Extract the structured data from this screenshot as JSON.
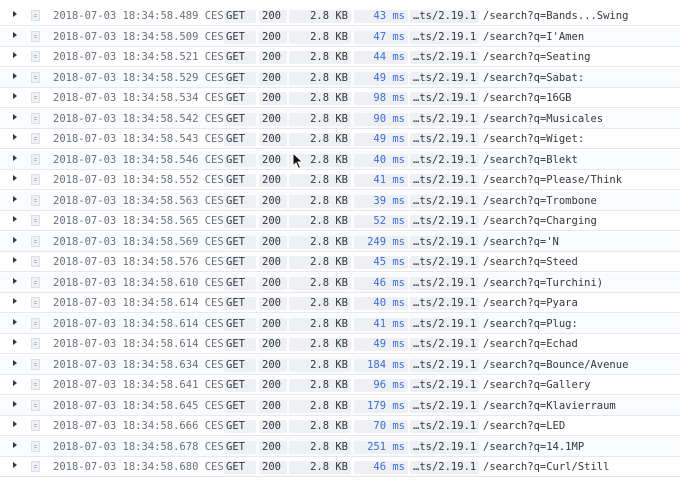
{
  "rows": [
    {
      "ts": "2018-07-03 18:34:58.489 CEST",
      "method": "GET",
      "status": "200",
      "bytes": "2.8 KB",
      "ms": "43 ms",
      "agent": "…ts/2.19.1",
      "url": "/search?q=Bands...Swing"
    },
    {
      "ts": "2018-07-03 18:34:58.509 CEST",
      "method": "GET",
      "status": "200",
      "bytes": "2.8 KB",
      "ms": "47 ms",
      "agent": "…ts/2.19.1",
      "url": "/search?q=I'Amen"
    },
    {
      "ts": "2018-07-03 18:34:58.521 CEST",
      "method": "GET",
      "status": "200",
      "bytes": "2.8 KB",
      "ms": "44 ms",
      "agent": "…ts/2.19.1",
      "url": "/search?q=Seating"
    },
    {
      "ts": "2018-07-03 18:34:58.529 CEST",
      "method": "GET",
      "status": "200",
      "bytes": "2.8 KB",
      "ms": "49 ms",
      "agent": "…ts/2.19.1",
      "url": "/search?q=Sabat:"
    },
    {
      "ts": "2018-07-03 18:34:58.534 CEST",
      "method": "GET",
      "status": "200",
      "bytes": "2.8 KB",
      "ms": "98 ms",
      "agent": "…ts/2.19.1",
      "url": "/search?q=16GB"
    },
    {
      "ts": "2018-07-03 18:34:58.542 CEST",
      "method": "GET",
      "status": "200",
      "bytes": "2.8 KB",
      "ms": "90 ms",
      "agent": "…ts/2.19.1",
      "url": "/search?q=Musicales"
    },
    {
      "ts": "2018-07-03 18:34:58.543 CEST",
      "method": "GET",
      "status": "200",
      "bytes": "2.8 KB",
      "ms": "49 ms",
      "agent": "…ts/2.19.1",
      "url": "/search?q=Wiget:"
    },
    {
      "ts": "2018-07-03 18:34:58.546 CEST",
      "method": "GET",
      "status": "200",
      "bytes": "2.8 KB",
      "ms": "40 ms",
      "agent": "…ts/2.19.1",
      "url": "/search?q=Blekt"
    },
    {
      "ts": "2018-07-03 18:34:58.552 CEST",
      "method": "GET",
      "status": "200",
      "bytes": "2.8 KB",
      "ms": "41 ms",
      "agent": "…ts/2.19.1",
      "url": "/search?q=Please/Think"
    },
    {
      "ts": "2018-07-03 18:34:58.563 CEST",
      "method": "GET",
      "status": "200",
      "bytes": "2.8 KB",
      "ms": "39 ms",
      "agent": "…ts/2.19.1",
      "url": "/search?q=Trombone"
    },
    {
      "ts": "2018-07-03 18:34:58.565 CEST",
      "method": "GET",
      "status": "200",
      "bytes": "2.8 KB",
      "ms": "52 ms",
      "agent": "…ts/2.19.1",
      "url": "/search?q=Charging"
    },
    {
      "ts": "2018-07-03 18:34:58.569 CEST",
      "method": "GET",
      "status": "200",
      "bytes": "2.8 KB",
      "ms": "249 ms",
      "agent": "…ts/2.19.1",
      "url": "/search?q='N"
    },
    {
      "ts": "2018-07-03 18:34:58.576 CEST",
      "method": "GET",
      "status": "200",
      "bytes": "2.8 KB",
      "ms": "45 ms",
      "agent": "…ts/2.19.1",
      "url": "/search?q=Steed"
    },
    {
      "ts": "2018-07-03 18:34:58.610 CEST",
      "method": "GET",
      "status": "200",
      "bytes": "2.8 KB",
      "ms": "46 ms",
      "agent": "…ts/2.19.1",
      "url": "/search?q=Turchini)"
    },
    {
      "ts": "2018-07-03 18:34:58.614 CEST",
      "method": "GET",
      "status": "200",
      "bytes": "2.8 KB",
      "ms": "40 ms",
      "agent": "…ts/2.19.1",
      "url": "/search?q=Pyara"
    },
    {
      "ts": "2018-07-03 18:34:58.614 CEST",
      "method": "GET",
      "status": "200",
      "bytes": "2.8 KB",
      "ms": "41 ms",
      "agent": "…ts/2.19.1",
      "url": "/search?q=Plug:"
    },
    {
      "ts": "2018-07-03 18:34:58.614 CEST",
      "method": "GET",
      "status": "200",
      "bytes": "2.8 KB",
      "ms": "49 ms",
      "agent": "…ts/2.19.1",
      "url": "/search?q=Echad"
    },
    {
      "ts": "2018-07-03 18:34:58.634 CEST",
      "method": "GET",
      "status": "200",
      "bytes": "2.8 KB",
      "ms": "184 ms",
      "agent": "…ts/2.19.1",
      "url": "/search?q=Bounce/Avenue"
    },
    {
      "ts": "2018-07-03 18:34:58.641 CEST",
      "method": "GET",
      "status": "200",
      "bytes": "2.8 KB",
      "ms": "96 ms",
      "agent": "…ts/2.19.1",
      "url": "/search?q=Gallery"
    },
    {
      "ts": "2018-07-03 18:34:58.645 CEST",
      "method": "GET",
      "status": "200",
      "bytes": "2.8 KB",
      "ms": "179 ms",
      "agent": "…ts/2.19.1",
      "url": "/search?q=Klavierraum"
    },
    {
      "ts": "2018-07-03 18:34:58.666 CEST",
      "method": "GET",
      "status": "200",
      "bytes": "2.8 KB",
      "ms": "70 ms",
      "agent": "…ts/2.19.1",
      "url": "/search?q=LED"
    },
    {
      "ts": "2018-07-03 18:34:58.678 CEST",
      "method": "GET",
      "status": "200",
      "bytes": "2.8 KB",
      "ms": "251 ms",
      "agent": "…ts/2.19.1",
      "url": "/search?q=14.1MP"
    },
    {
      "ts": "2018-07-03 18:34:58.680 CEST",
      "method": "GET",
      "status": "200",
      "bytes": "2.8 KB",
      "ms": "46 ms",
      "agent": "…ts/2.19.1",
      "url": "/search?q=Curl/Still"
    }
  ],
  "colors": {
    "duration": "#3b6ed6",
    "pill_bg": "#eef0f3",
    "row_border": "#e6e8ec"
  },
  "icons": {
    "expand": "chevron-right-icon",
    "document": "document-icon",
    "cursor": "mouse-pointer-icon"
  }
}
